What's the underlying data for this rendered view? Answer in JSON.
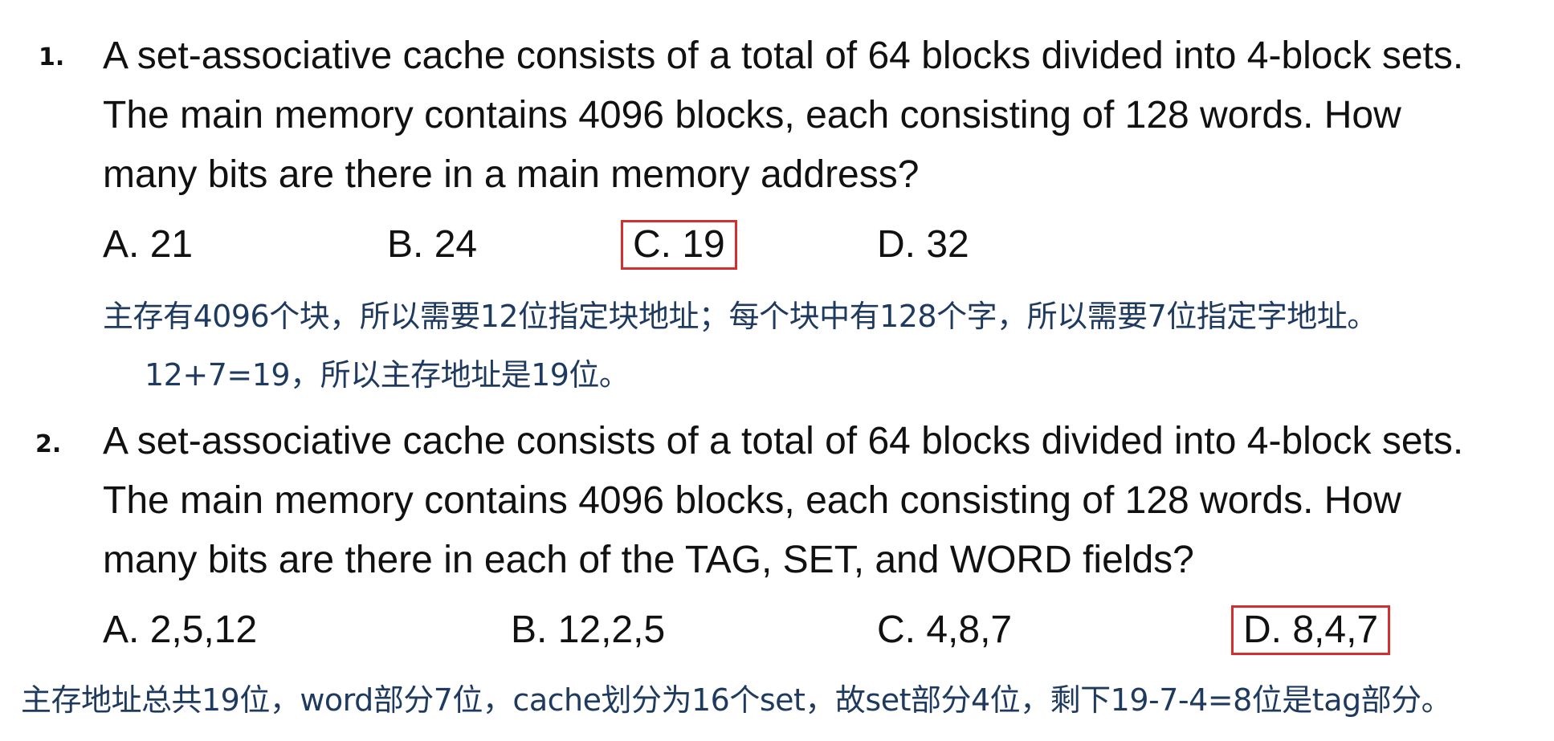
{
  "questions": [
    {
      "number": "1.",
      "lines": [
        "A set-associative cache consists of a total of 64 blocks divided into 4-block sets.",
        "The main memory contains 4096 blocks, each consisting of 128 words. How",
        "many bits are there in a main memory address?"
      ],
      "options": [
        "A. 21",
        "B. 24",
        "C. 19",
        "D. 32"
      ],
      "selected_option": "C. 19",
      "explanation": [
        "主存有4096个块，所以需要12位指定块地址；每个块中有128个字，所以需要7位指定字地址。",
        "12+7=19，所以主存地址是19位。"
      ]
    },
    {
      "number": "2.",
      "lines": [
        "A set-associative cache consists of a total of 64 blocks divided into 4-block sets.",
        "The main memory contains 4096 blocks, each consisting of 128 words. How",
        "many bits are there in each of the TAG, SET, and WORD fields?"
      ],
      "options": [
        "A. 2,5,12",
        "B. 12,2,5",
        "C. 4,8,7",
        "D. 8,4,7"
      ],
      "selected_option": "D. 8,4,7",
      "explanation": [
        "主存地址总共19位，word部分7位，cache划分为16个set，故set部分4位，剩下19-7-4=8位是tag部分。"
      ]
    }
  ],
  "colors": {
    "question_text": "#111111",
    "explanation_text": "#1f3a5f",
    "answer_box": "#d32f2f"
  }
}
